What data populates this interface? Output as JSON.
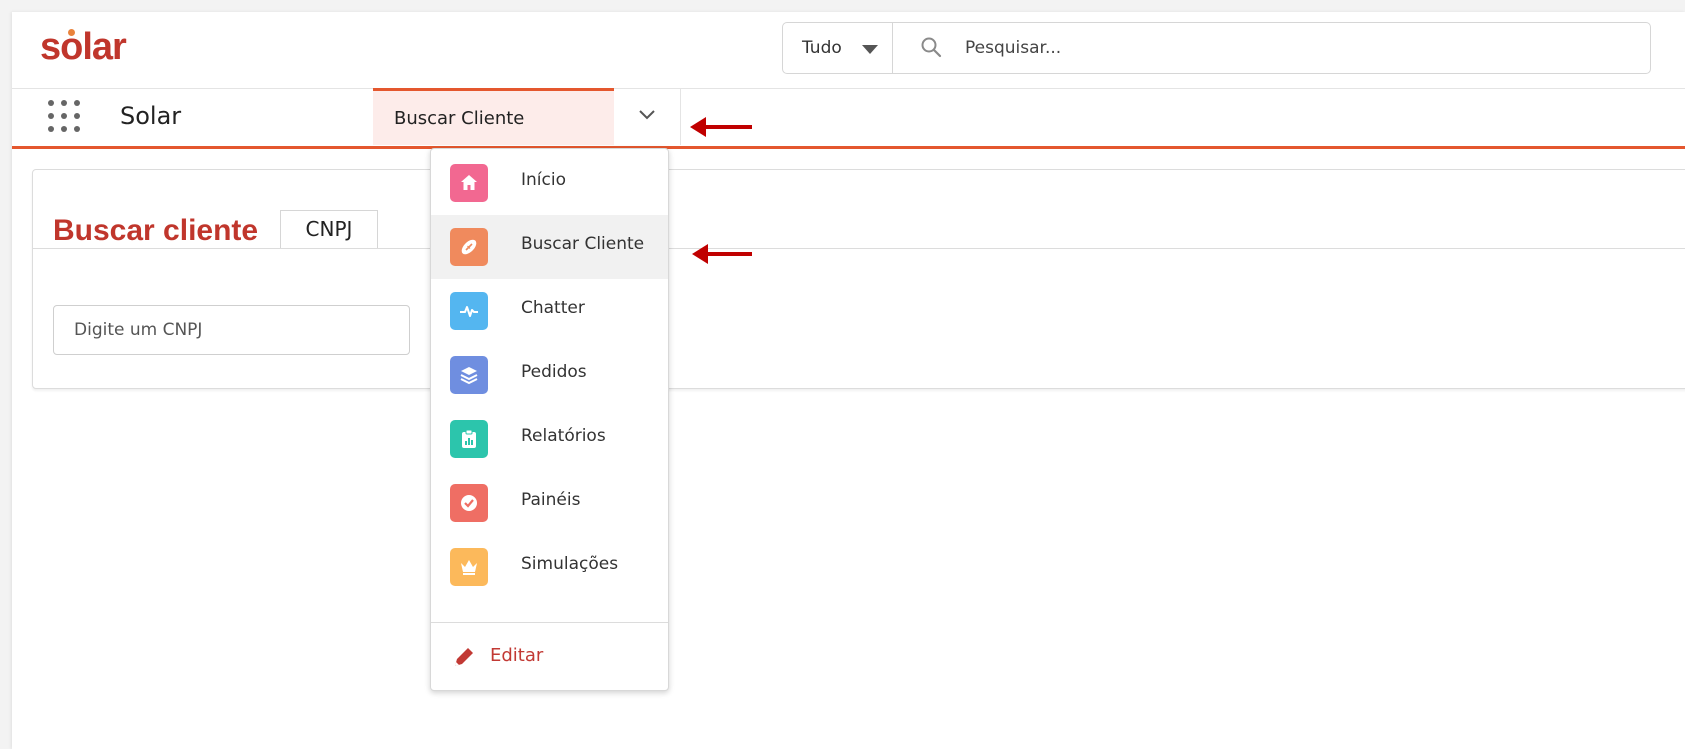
{
  "header": {
    "logo_text": "solar",
    "search_scope": "Tudo",
    "search_placeholder": "Pesquisar..."
  },
  "navbar": {
    "app_name": "Solar",
    "active_tab": "Buscar Cliente"
  },
  "card": {
    "title": "Buscar cliente",
    "tab_label": "CNPJ",
    "input_placeholder": "Digite um CNPJ"
  },
  "dropdown": {
    "items": [
      {
        "label": "Início",
        "icon": "home-icon",
        "color": "#f26891"
      },
      {
        "label": "Buscar Cliente",
        "icon": "football-icon",
        "color": "#f08a5d",
        "selected": true
      },
      {
        "label": "Chatter",
        "icon": "pulse-icon",
        "color": "#54b6f0"
      },
      {
        "label": "Pedidos",
        "icon": "layers-icon",
        "color": "#6f8ee0"
      },
      {
        "label": "Relatórios",
        "icon": "report-icon",
        "color": "#2cc5ac"
      },
      {
        "label": "Painéis",
        "icon": "dashboard-icon",
        "color": "#ef6e64"
      },
      {
        "label": "Simulações",
        "icon": "crown-icon",
        "color": "#fcb95b"
      }
    ],
    "edit_label": "Editar"
  },
  "colors": {
    "brand": "#c0362c",
    "accent": "#e4572e",
    "annotation_arrow": "#c00000"
  }
}
